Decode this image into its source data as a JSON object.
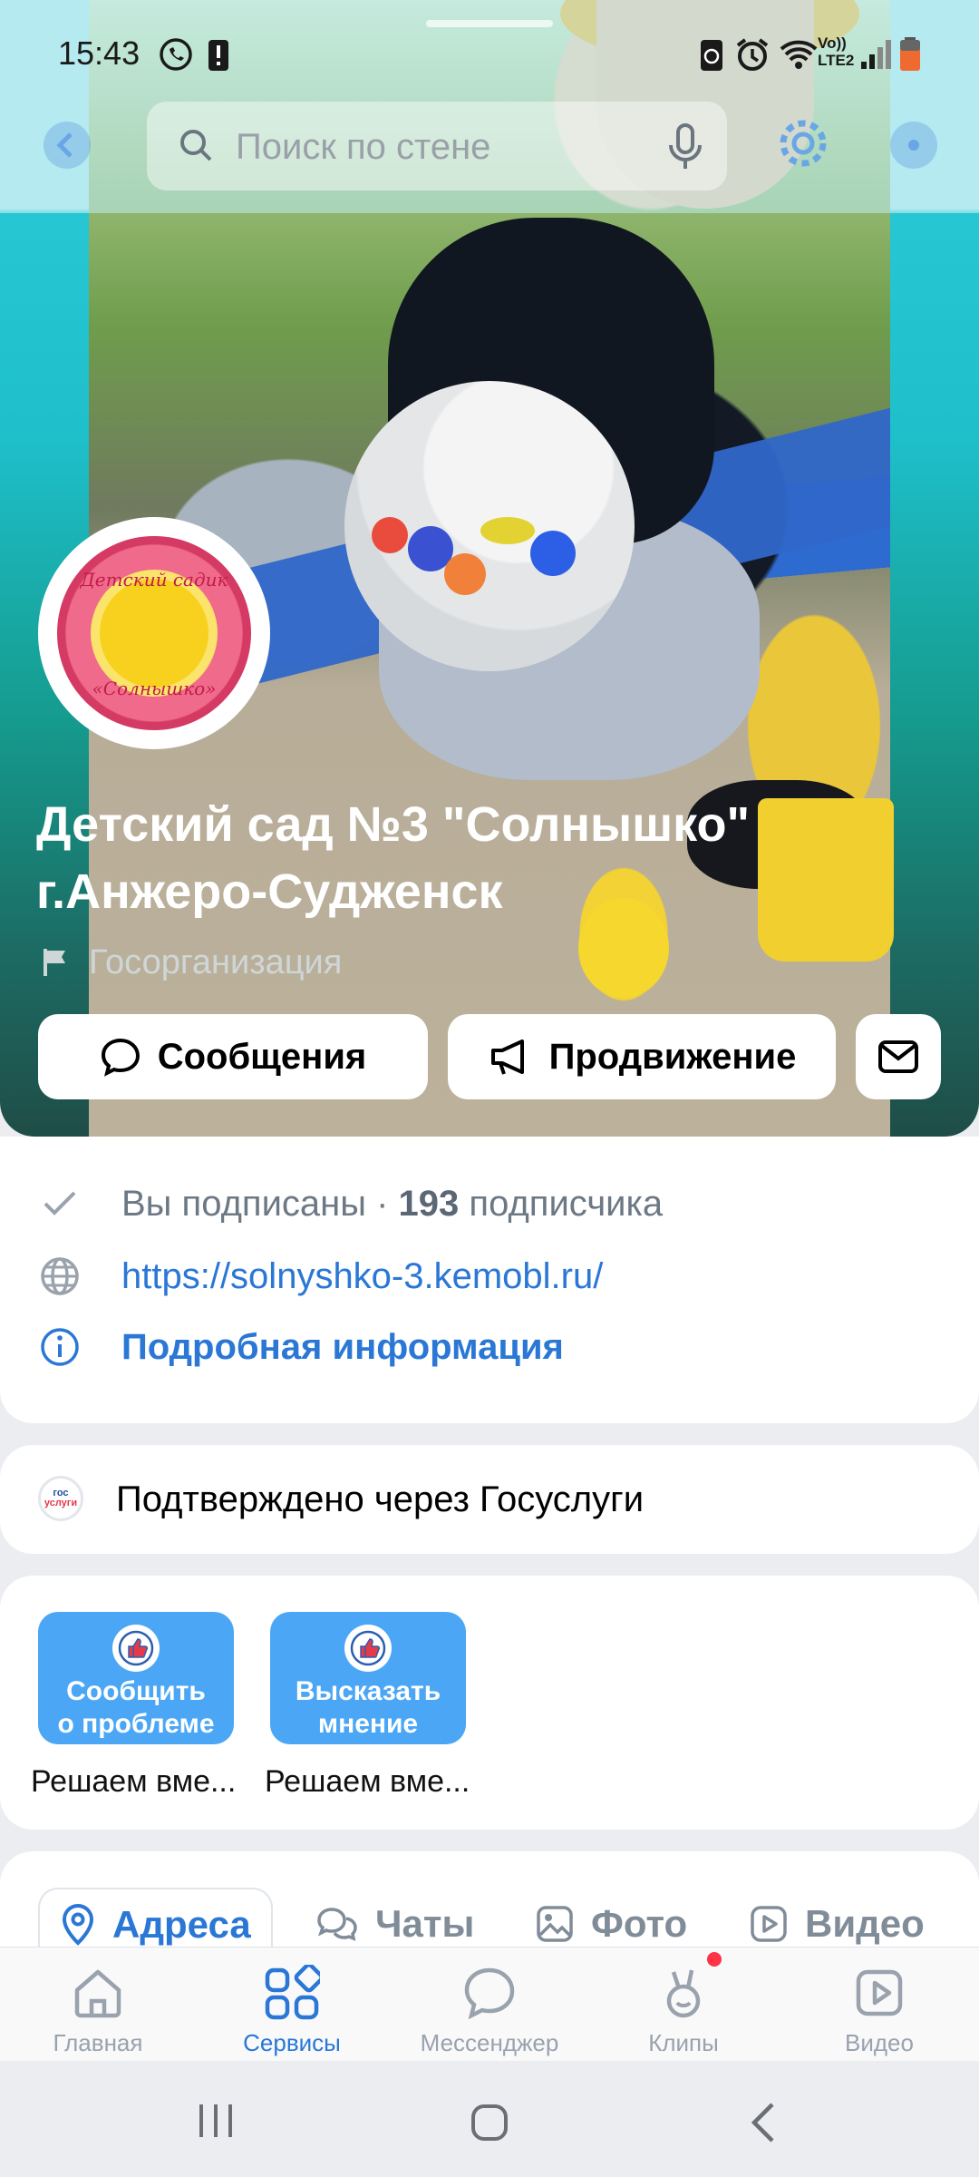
{
  "status_bar": {
    "time": "15:43",
    "network_label": "Vo)) LTE2"
  },
  "search": {
    "placeholder": "Поиск по стене"
  },
  "group": {
    "avatar_text_top": "Детский садик",
    "avatar_text_bottom": "«Солнышко»",
    "title_line1": "Детский сад №3 \"Солнышко\"",
    "title_line2": "г.Анжеро-Судженск",
    "category": "Госорганизация"
  },
  "actions": {
    "messages": "Сообщения",
    "promotion": "Продвижение"
  },
  "info": {
    "subscribed": "Вы подписаны · ",
    "subscribers_count": "193",
    "subscribers_word": " подписчика",
    "website": "https://solnyshko-3.kemobl.ru/",
    "details": "Подробная информация"
  },
  "gosuslugi": {
    "logo_line1": "гос",
    "logo_line2": "услуги",
    "text": "Подтверждено через Госуслуги"
  },
  "widgets": [
    {
      "line1": "Сообщить",
      "line2": "о проблеме",
      "caption": "Решаем вме..."
    },
    {
      "line1": "Высказать",
      "line2": "мнение",
      "caption": "Решаем вме..."
    }
  ],
  "tabs": [
    "Адреса",
    "Чаты",
    "Фото",
    "Видео"
  ],
  "bottom_nav": [
    "Главная",
    "Сервисы",
    "Мессенджер",
    "Клипы",
    "Видео"
  ],
  "colors": {
    "accent": "#2a77d6",
    "widget_blue": "#4ba7f5",
    "badge_red": "#ff3347"
  }
}
